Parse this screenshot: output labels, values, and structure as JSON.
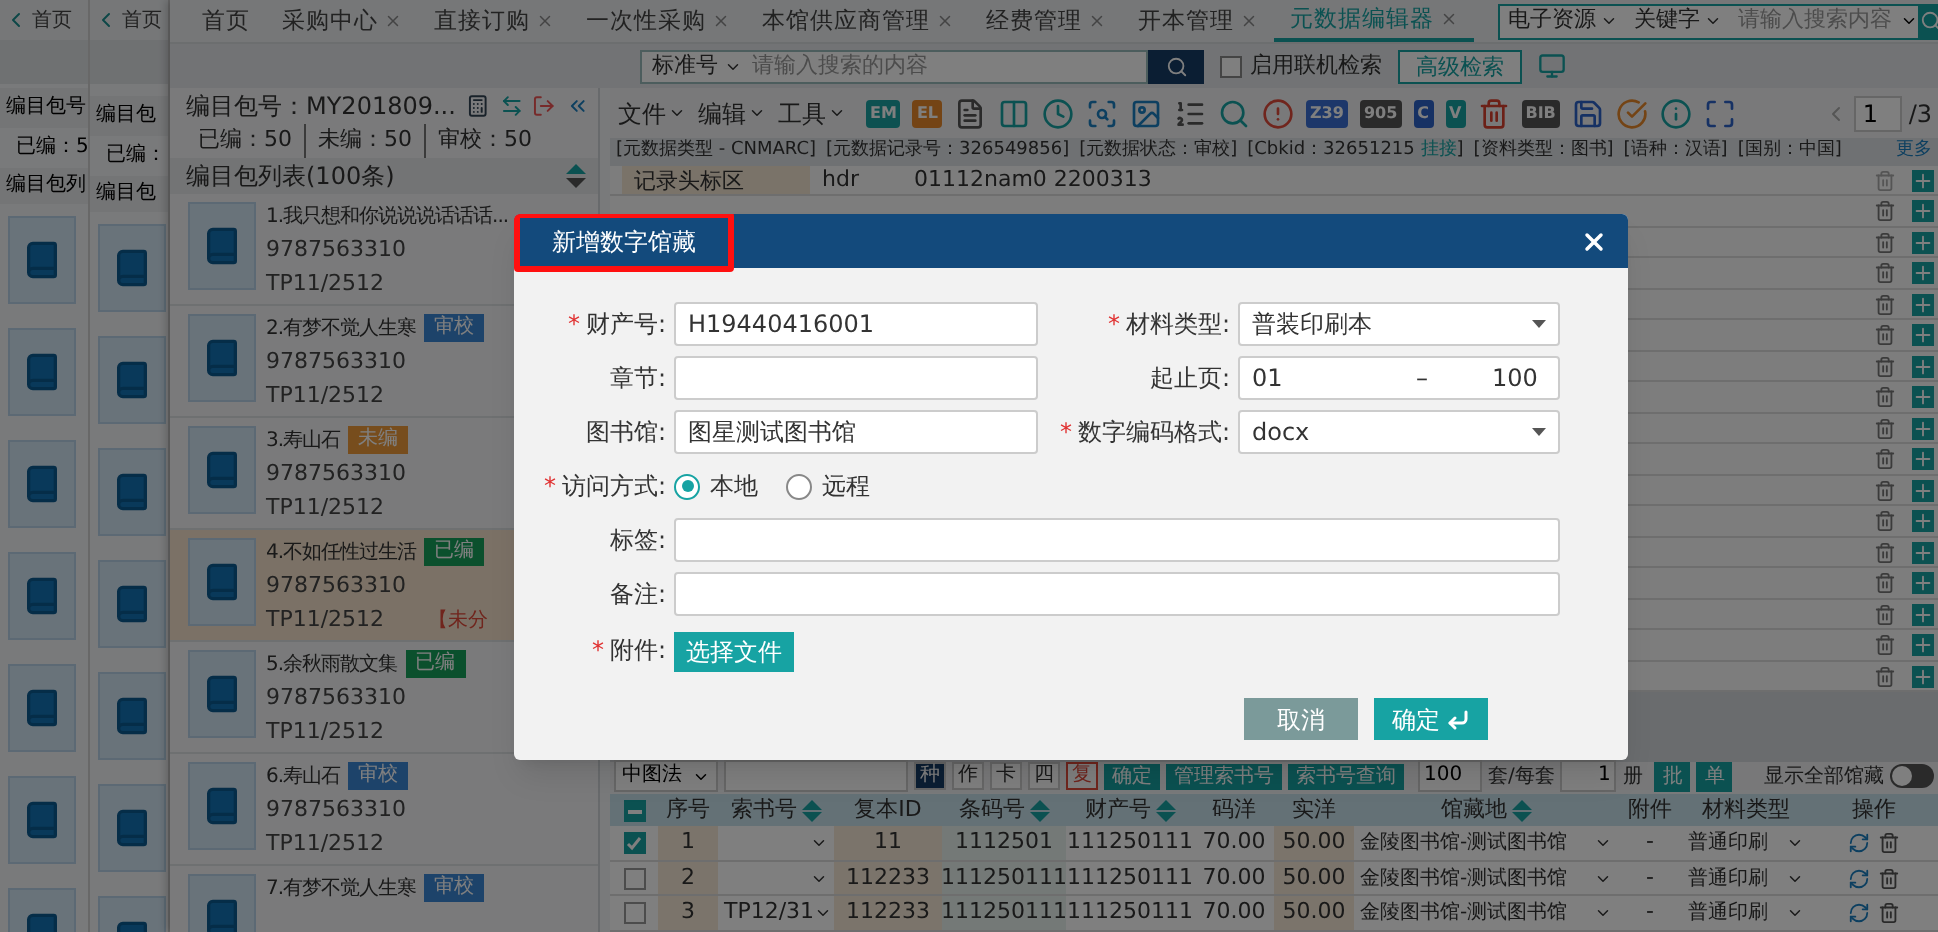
{
  "back_windows": [
    {
      "tab": "首页",
      "package_label": "编目包号",
      "stats": "已编：5",
      "list_label": "编目包列"
    },
    {
      "tab": "首页",
      "package_label": "编目包",
      "stats": "已编：",
      "list_label": "编目包"
    }
  ],
  "tabs": [
    {
      "label": "首页",
      "closable": false,
      "selected": false
    },
    {
      "label": "采购中心",
      "closable": true,
      "selected": false
    },
    {
      "label": "直接订购",
      "closable": true,
      "selected": false
    },
    {
      "label": "一次性采购",
      "closable": true,
      "selected": false
    },
    {
      "label": "本馆供应商管理",
      "closable": true,
      "selected": false
    },
    {
      "label": "经费管理",
      "closable": true,
      "selected": false
    },
    {
      "label": "开本管理",
      "closable": true,
      "selected": false
    },
    {
      "label": "元数据编辑器",
      "closable": true,
      "selected": true
    }
  ],
  "global_search": {
    "scope": "电子资源",
    "field": "关键字",
    "placeholder": "请输入搜索内容"
  },
  "editor_search": {
    "field": "标准号",
    "placeholder": "请输入搜索的内容",
    "online_label": "启用联机检索",
    "online_checked": false,
    "advanced": "高级检索"
  },
  "package": {
    "title": "编目包号：MY201809...",
    "stats": [
      "已编：50",
      "未编：50",
      "审校：50"
    ],
    "list_title": "编目包列表(100条)",
    "items": [
      {
        "title": "1.我只想和你说说说话话话...",
        "isbn": "9787563310",
        "call_no": "TP11/2512",
        "selected": false
      },
      {
        "title": "2.有梦不觉人生寒",
        "badge": "审校",
        "kind": "review",
        "isbn": "9787563310",
        "call_no": "TP11/2512",
        "selected": false
      },
      {
        "title": "3.寿山石",
        "badge": "未编",
        "kind": "todo",
        "isbn": "9787563310",
        "call_no": "TP11/2512",
        "selected": false
      },
      {
        "title": "4.不如任性过生活",
        "badge": "已编",
        "kind": "done",
        "isbn": "9787563310",
        "call_no": "TP11/2512",
        "note": "【未分",
        "selected": true
      },
      {
        "title": "5.余秋雨散文集",
        "badge": "已编",
        "kind": "done",
        "isbn": "9787563310",
        "call_no": "TP11/2512",
        "selected": false
      },
      {
        "title": "6.寿山石",
        "badge": "审校",
        "kind": "review",
        "isbn": "9787563310",
        "call_no": "TP11/2512",
        "selected": false
      },
      {
        "title": "7.有梦不觉人生寒",
        "badge": "审校",
        "kind": "review",
        "selected": false
      }
    ]
  },
  "editor": {
    "menus": [
      "文件",
      "编辑",
      "工具"
    ],
    "toolbar_labels": [
      "EM",
      "EL",
      "Z39",
      "905",
      "C",
      "V",
      "BIB"
    ],
    "page": "1",
    "page_total": "/3",
    "info": [
      {
        "text": "[元数据类型 - CNMARC]"
      },
      {
        "text": "[元数据记录号：326549856]"
      },
      {
        "text": "[元数据状态：审校]"
      },
      {
        "text": "[Cbkid：32651215",
        "link": "挂接",
        "close": "]"
      },
      {
        "text": "[资料类型：图书]"
      },
      {
        "text": "[语种：汉语]"
      },
      {
        "text": "[国别：中国]"
      }
    ],
    "more": "更多",
    "marc_rows": [
      {
        "name": "记录头标区",
        "tag": "hdr",
        "value": "01112nam0 2200313"
      }
    ]
  },
  "holdings": {
    "classification": "中图法",
    "modes": [
      {
        "label": "种",
        "kind": "toggle",
        "selected": true
      },
      {
        "label": "作",
        "kind": "toggle",
        "selected": false
      },
      {
        "label": "卡",
        "kind": "toggle",
        "selected": false
      },
      {
        "label": "四",
        "kind": "toggle",
        "selected": false
      },
      {
        "label": "复",
        "kind": "warning",
        "selected": false
      }
    ],
    "actions": [
      "确定",
      "管理索书号",
      "索书号查询"
    ],
    "sets": "100",
    "sets_label": "套/每套",
    "copies": "1",
    "copies_label": "册",
    "batch": "批",
    "single": "单",
    "show_all": "显示全部馆藏",
    "show_all_on": false,
    "header_indeterminate": true,
    "columns": [
      {
        "label": "序号",
        "sortable": false
      },
      {
        "label": "索书号",
        "sortable": true
      },
      {
        "label": "复本ID",
        "sortable": false
      },
      {
        "label": "条码号",
        "sortable": true
      },
      {
        "label": "财产号",
        "sortable": true
      },
      {
        "label": "码洋",
        "sortable": false
      },
      {
        "label": "实洋",
        "sortable": false
      },
      {
        "label": "馆藏地",
        "sortable": true
      },
      {
        "label": "附件",
        "sortable": false
      },
      {
        "label": "材料类型",
        "sortable": false
      },
      {
        "label": "操作",
        "sortable": false
      }
    ],
    "rows": [
      {
        "checked": true,
        "seq": "1",
        "call_no": "",
        "copy_id": "11",
        "barcode": "1112501",
        "property_no": "111250111",
        "price": "70.00",
        "net_price": "50.00",
        "location": "金陵图书馆-测试图书馆",
        "attachment": "-",
        "material": "普通印刷"
      },
      {
        "checked": false,
        "seq": "2",
        "call_no": "",
        "copy_id": "112233",
        "barcode": "111250111",
        "property_no": "111250111",
        "price": "70.00",
        "net_price": "50.00",
        "location": "金陵图书馆-测试图书馆",
        "attachment": "-",
        "material": "普通印刷"
      },
      {
        "checked": false,
        "seq": "3",
        "call_no": "TP12/31",
        "copy_id": "112233",
        "barcode": "111250111",
        "property_no": "111250111",
        "price": "70.00",
        "net_price": "50.00",
        "location": "金陵图书馆-测试图书馆",
        "attachment": "-",
        "material": "普通印刷"
      }
    ]
  },
  "dialog": {
    "title": "新增数字馆藏",
    "title_highlighted": true,
    "rows": [
      [
        {
          "kind": "input",
          "marker": "*",
          "label": "财产号:",
          "value": "H19440416001"
        },
        {
          "kind": "select",
          "marker": "*",
          "label": "材料类型:",
          "value": "普装印刷本"
        }
      ],
      [
        {
          "kind": "input",
          "label": "章节:"
        },
        {
          "kind": "range",
          "label": "起止页:",
          "from": "01",
          "separator": "–",
          "to": "100"
        }
      ],
      [
        {
          "kind": "readonly",
          "label": "图书馆:",
          "value": "图星测试图书馆"
        },
        {
          "kind": "select",
          "marker": "*",
          "label": "数字编码格式:",
          "value": "docx"
        }
      ],
      [
        {
          "kind": "radio",
          "marker": "*",
          "label": "访问方式:",
          "options": [
            {
              "label": "本地",
              "selected": true
            },
            {
              "label": "远程",
              "selected": false
            }
          ]
        }
      ],
      [
        {
          "kind": "input",
          "label": "标签:"
        }
      ],
      [
        {
          "kind": "input",
          "label": "备注:"
        }
      ],
      [
        {
          "kind": "file",
          "marker": "*",
          "label": "附件:",
          "button": "选择文件"
        }
      ]
    ],
    "cancel": "取消",
    "confirm": "确定"
  }
}
